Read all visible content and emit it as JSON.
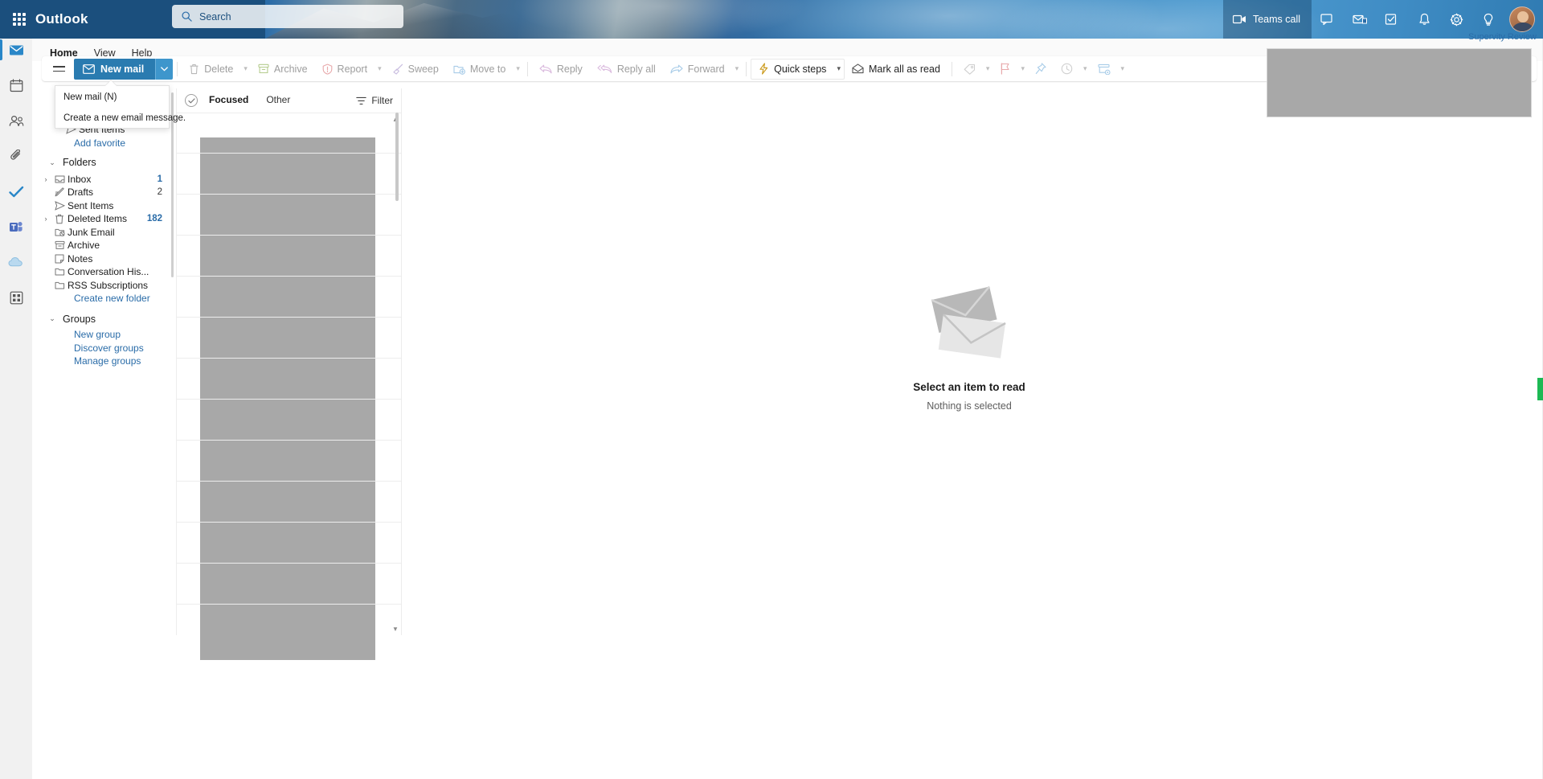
{
  "app": {
    "brand": "Outlook",
    "waffle_label": "app-launcher"
  },
  "search": {
    "placeholder": "Search",
    "value": "",
    "icon": "search-icon"
  },
  "header_right": {
    "teams_call": "Teams call",
    "icons": [
      "meet-now-icon",
      "teams-chat-icon",
      "to-do-icon",
      "notifications-icon",
      "settings-icon",
      "help-icon"
    ],
    "avatar": "user-avatar"
  },
  "ribbon": {
    "tabs": [
      {
        "label": "Home",
        "active": true
      },
      {
        "label": "View",
        "active": false
      },
      {
        "label": "Help",
        "active": false
      }
    ]
  },
  "toolbar": {
    "hamburger": "toggle-pane-button",
    "new_mail": "New mail",
    "items": [
      {
        "label": "Delete",
        "icon": "trash-icon",
        "enabled": false,
        "caret": true
      },
      {
        "label": "Archive",
        "icon": "archive-icon",
        "enabled": false,
        "caret": false
      },
      {
        "label": "Report",
        "icon": "report-icon",
        "enabled": false,
        "caret": true
      },
      {
        "label": "Sweep",
        "icon": "sweep-icon",
        "enabled": false,
        "caret": false
      },
      {
        "label": "Move to",
        "icon": "move-to-icon",
        "enabled": false,
        "caret": true
      },
      {
        "label": "Reply",
        "icon": "reply-icon",
        "enabled": false,
        "caret": false
      },
      {
        "label": "Reply all",
        "icon": "reply-all-icon",
        "enabled": false,
        "caret": false
      },
      {
        "label": "Forward",
        "icon": "forward-icon",
        "enabled": false,
        "caret": true
      }
    ],
    "quick_steps": "Quick steps",
    "mark_all_as_read": "Mark all as read",
    "trailing_icons": [
      {
        "icon": "tag-icon",
        "caret": true
      },
      {
        "icon": "flag-icon",
        "caret": true
      },
      {
        "icon": "pin-icon",
        "caret": false
      },
      {
        "icon": "snooze-clock-icon",
        "caret": true
      },
      {
        "icon": "rules-icon",
        "caret": true
      }
    ]
  },
  "tooltip": {
    "title": "New mail (N)",
    "description": "Create a new email message."
  },
  "sidebar": {
    "favorites_partial": "Sent Items",
    "add_favorite": "Add favorite",
    "folders_header": "Folders",
    "folders": [
      {
        "label": "Inbox",
        "count": "1",
        "icon": "inbox-icon",
        "expandable": true,
        "count_accent": true
      },
      {
        "label": "Drafts",
        "count": "2",
        "icon": "drafts-icon",
        "expandable": false,
        "count_accent": false
      },
      {
        "label": "Sent Items",
        "count": "",
        "icon": "sent-icon",
        "expandable": false,
        "count_accent": false
      },
      {
        "label": "Deleted Items",
        "count": "182",
        "icon": "trash-icon",
        "expandable": true,
        "count_accent": true
      },
      {
        "label": "Junk Email",
        "count": "",
        "icon": "junk-icon",
        "expandable": false,
        "count_accent": false
      },
      {
        "label": "Archive",
        "count": "",
        "icon": "archive-icon",
        "expandable": false,
        "count_accent": false
      },
      {
        "label": "Notes",
        "count": "",
        "icon": "notes-icon",
        "expandable": false,
        "count_accent": false
      },
      {
        "label": "Conversation His...",
        "count": "",
        "icon": "folder-icon",
        "expandable": false,
        "count_accent": false
      },
      {
        "label": "RSS Subscriptions",
        "count": "",
        "icon": "folder-icon",
        "expandable": false,
        "count_accent": false
      }
    ],
    "create_new_folder": "Create new folder",
    "groups_header": "Groups",
    "group_links": [
      "New group",
      "Discover groups",
      "Manage groups"
    ]
  },
  "message_list": {
    "select_all_icon": "select-all-checkmark-icon",
    "pivots": [
      {
        "label": "Focused",
        "active": true
      },
      {
        "label": "Other",
        "active": false
      }
    ],
    "filter_label": "Filter",
    "filter_icon": "filter-icon"
  },
  "reading_pane": {
    "illustration": "empty-envelopes-illustration",
    "title": "Select an item to read",
    "subtitle": "Nothing is selected"
  },
  "overlays": {
    "supervity_label": "Supervity Review"
  },
  "colors": {
    "accent": "#2a7bb0",
    "header_blue": "#2a6ca8",
    "link": "#2a6ca8",
    "tab_underline": "#2a87c8",
    "redacted": "#a8a8a8",
    "green_marker": "#1db954"
  }
}
